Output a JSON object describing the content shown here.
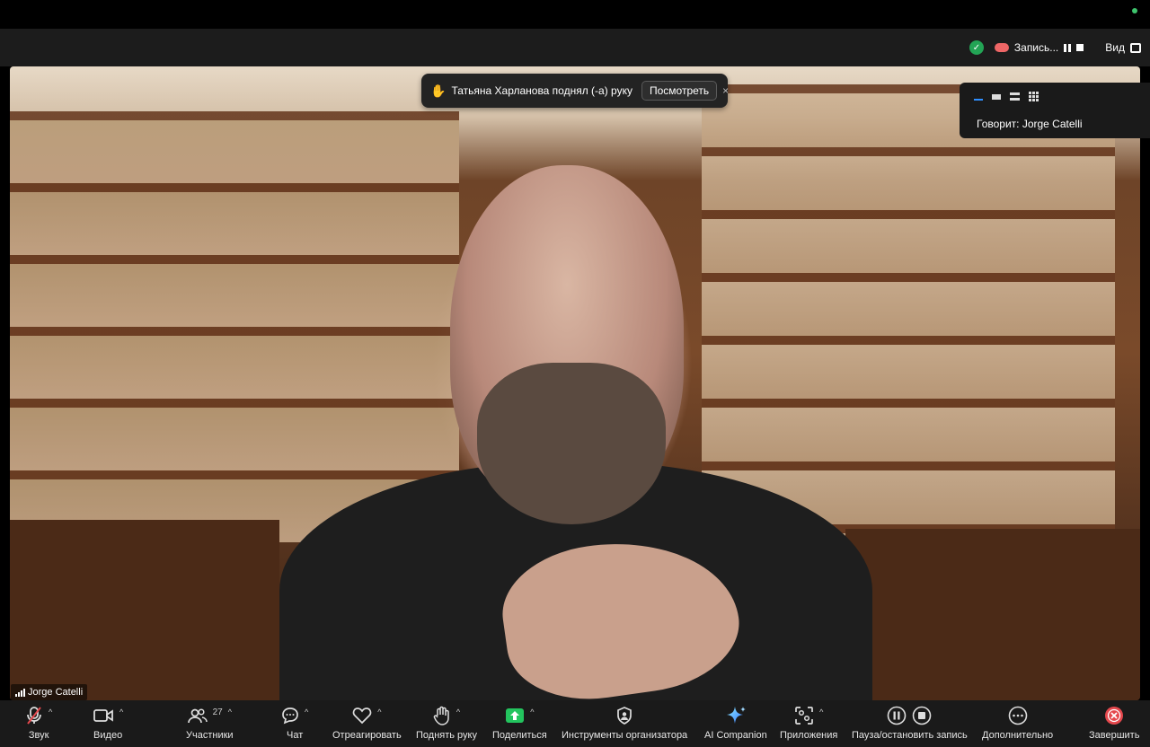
{
  "header": {
    "recording_label": "Запись...",
    "view_label": "Вид"
  },
  "notification": {
    "text": "Татьяна Харланова поднял (-а) руку",
    "view_button": "Посмотреть",
    "close": "×"
  },
  "speaker_panel": {
    "speaking_label": "Говорит: Jorge Catelli"
  },
  "video": {
    "participant_name": "Jorge Catelli"
  },
  "toolbar": {
    "audio": "Звук",
    "video": "Видео",
    "participants": "Участники",
    "participants_count": "27",
    "chat": "Чат",
    "react": "Отреагировать",
    "raise_hand": "Поднять руку",
    "share": "Поделиться",
    "host_tools": "Инструменты организатора",
    "ai_companion": "AI Companion",
    "apps": "Приложения",
    "pause_stop_recording": "Пауза/остановить запись",
    "more": "Дополнительно",
    "end": "Завершить"
  },
  "colors": {
    "toolbar_bg": "#1a1a1a",
    "accent_blue": "#2f8fff",
    "share_green": "#23c45e",
    "end_red": "#e5484d",
    "shield_green": "#23a455"
  }
}
